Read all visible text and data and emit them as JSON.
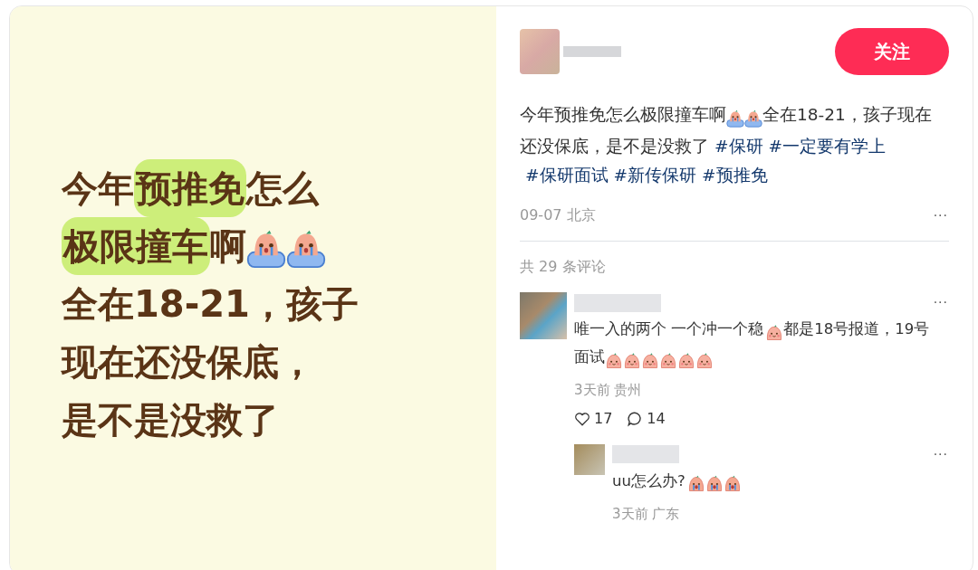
{
  "poster": {
    "lines": [
      [
        {
          "text": "今年"
        },
        {
          "text": "预推免",
          "highlight": true
        },
        {
          "text": "怎么"
        }
      ],
      [
        {
          "text": "极限撞车",
          "highlight": true
        },
        {
          "text": "啊"
        },
        {
          "kind": "crying-float"
        },
        {
          "kind": "crying-float"
        }
      ],
      [
        {
          "text": "全在18-21，孩子"
        }
      ],
      [
        {
          "text": "现在还没保底，"
        }
      ],
      [
        {
          "text": "是不是没救了"
        }
      ]
    ]
  },
  "post": {
    "follow_button": "关注",
    "body": [
      {
        "kind": "text",
        "text": "今年预推免怎么极限撞车啊"
      },
      {
        "kind": "crying-float"
      },
      {
        "kind": "crying-float"
      },
      {
        "kind": "text",
        "text": "全在18-21，孩子现在还没保底，是不是没救了"
      },
      {
        "kind": "tag",
        "text": "#保研"
      },
      {
        "kind": "tag",
        "text": "#一定要有学上"
      },
      {
        "kind": "tag",
        "text": "#保研面试"
      },
      {
        "kind": "tag",
        "text": "#新传保研"
      },
      {
        "kind": "tag",
        "text": "#预推免"
      }
    ],
    "meta": "09-07 北京",
    "more": "···"
  },
  "comments_count": "共 29 条评论",
  "comments": [
    {
      "body": [
        {
          "kind": "text",
          "text": "唯一入的两个 一个冲一个稳"
        },
        {
          "kind": "smile"
        },
        {
          "kind": "text",
          "text": "都是18号报道，19号面试"
        },
        {
          "kind": "smile"
        },
        {
          "kind": "smile"
        },
        {
          "kind": "smile"
        },
        {
          "kind": "smile"
        },
        {
          "kind": "smile"
        },
        {
          "kind": "smile"
        }
      ],
      "meta": "3天前 贵州",
      "likes": "17",
      "replies_count": "14",
      "more": "···",
      "replies": [
        {
          "body": [
            {
              "kind": "text",
              "text": "uu怎么办?"
            },
            {
              "kind": "crying"
            },
            {
              "kind": "crying"
            },
            {
              "kind": "crying"
            }
          ],
          "meta": "3天前 广东",
          "more": "···"
        }
      ]
    }
  ]
}
